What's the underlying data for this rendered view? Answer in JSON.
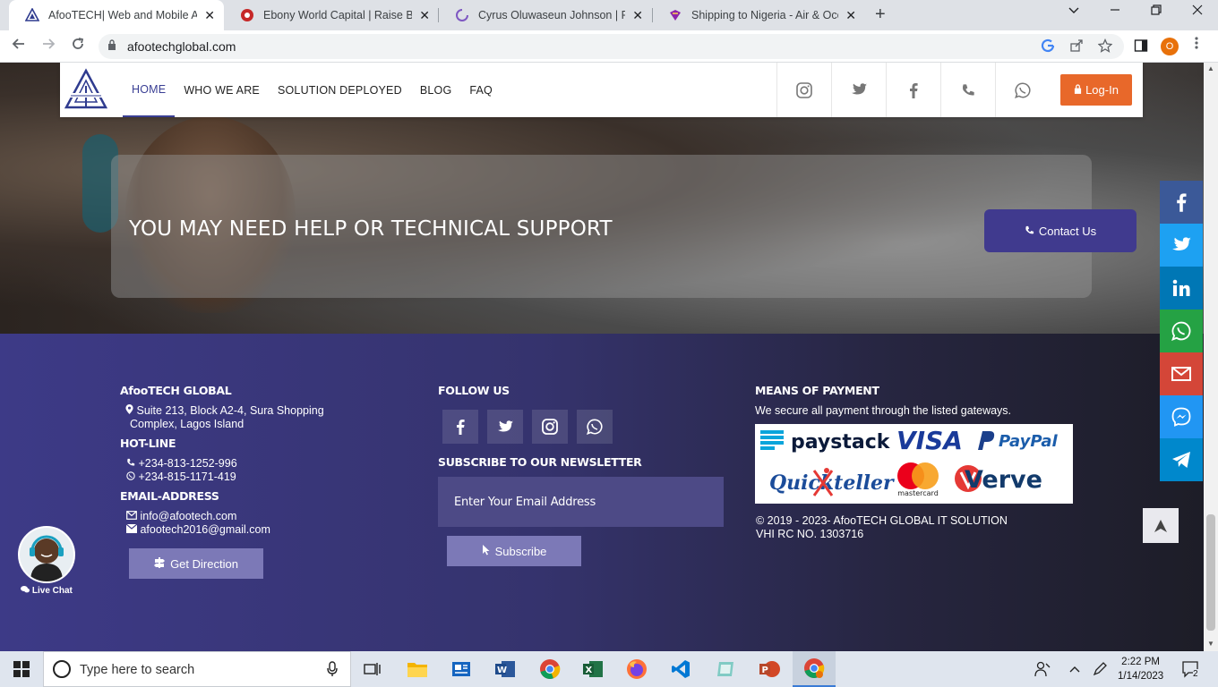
{
  "browser": {
    "tabs": [
      {
        "title": "AfooTECH| Web and Mobile App",
        "active": true,
        "favicon": "afootech-favicon"
      },
      {
        "title": "Ebony World Capital | Raise Busin",
        "active": false,
        "favicon": "ebony-favicon"
      },
      {
        "title": "Cyrus Oluwaseun Johnson | Perso",
        "active": false,
        "favicon": "spinner-favicon"
      },
      {
        "title": "Shipping to Nigeria - Air & Ocea",
        "active": false,
        "favicon": "shipping-favicon"
      }
    ],
    "url": "afootechglobal.com",
    "profile_initial": "O"
  },
  "header": {
    "nav": [
      "HOME",
      "WHO WE ARE",
      "SOLUTION DEPLOYED",
      "BLOG",
      "FAQ"
    ],
    "active_nav": "HOME",
    "social_icons": [
      "instagram-icon",
      "twitter-icon",
      "facebook-icon",
      "phone-icon",
      "whatsapp-icon"
    ],
    "login_label": "Log-In",
    "accent": "#3a3f94",
    "login_color": "#e8682a"
  },
  "hero": {
    "heading": "YOU MAY NEED HELP OR TECHNICAL SUPPORT",
    "contact_label": "Contact Us",
    "contact_color": "#403a8e"
  },
  "share_bar": [
    "facebook-icon",
    "twitter-icon",
    "linkedin-icon",
    "whatsapp-icon",
    "gmail-icon",
    "messenger-icon",
    "telegram-icon"
  ],
  "footer": {
    "company": {
      "title": "AfooTECH GLOBAL",
      "address_line1": "Suite 213, Block A2-4, Sura Shopping",
      "address_line2": "Complex, Lagos Island",
      "hotline_title": "HOT-LINE",
      "phone1": "+234-813-1252-996",
      "phone2": "+234-815-1171-419",
      "email_title": "EMAIL-ADDRESS",
      "email1": "info@afootech.com",
      "email2": "afootech2016@gmail.com",
      "direction_label": "Get Direction"
    },
    "follow": {
      "title": "FOLLOW US",
      "icons": [
        "facebook-icon",
        "twitter-icon",
        "instagram-icon",
        "whatsapp-icon"
      ],
      "newsletter_title": "SUBSCRIBE TO OUR NEWSLETTER",
      "email_placeholder": "Enter Your Email Address",
      "subscribe_label": "Subscribe"
    },
    "payment": {
      "title": "MEANS OF PAYMENT",
      "subtitle": "We secure all payment through the listed gateways.",
      "logos": [
        "paystack",
        "VISA",
        "PayPal",
        "Quickteller",
        "mastercard",
        "Verve"
      ],
      "copyright": "© 2019 - 2023- AfooTECH GLOBAL IT SOLUTION",
      "rc": "VHI RC NO. 1303716"
    },
    "live_chat": "Live Chat",
    "back_to_top": "➤"
  },
  "taskbar": {
    "search_placeholder": "Type here to search",
    "time": "2:22 PM",
    "date": "1/14/2023",
    "notifications": "2"
  }
}
